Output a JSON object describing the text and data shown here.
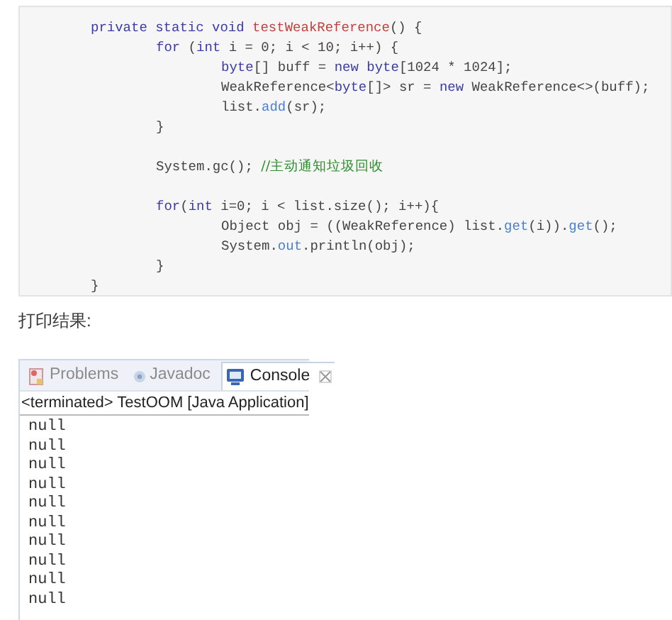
{
  "code": [
    {
      "kind": "line",
      "tokens": [
        {
          "kind": "keyword",
          "text": "private static void "
        },
        {
          "kind": "method",
          "text": "testWeakReference"
        },
        {
          "kind": "plain",
          "text": "() {"
        }
      ],
      "children": [
        {
          "kind": "line",
          "tokens": [
            {
              "kind": "keyword",
              "text": "for"
            },
            {
              "kind": "plain",
              "text": " ("
            },
            {
              "kind": "keyword",
              "text": "int"
            },
            {
              "kind": "plain",
              "text": " i = 0; i < 10; i++) {"
            }
          ],
          "children": [
            {
              "kind": "line",
              "tokens": [
                {
                  "kind": "keyword",
                  "text": "byte"
                },
                {
                  "kind": "plain",
                  "text": "[] buff = "
                },
                {
                  "kind": "keyword",
                  "text": "new byte"
                },
                {
                  "kind": "plain",
                  "text": "[1024 * 1024];"
                }
              ]
            },
            {
              "kind": "line",
              "tokens": [
                {
                  "kind": "plain",
                  "text": "WeakReference<"
                },
                {
                  "kind": "keyword",
                  "text": "byte"
                },
                {
                  "kind": "plain",
                  "text": "[]> sr = "
                },
                {
                  "kind": "keyword",
                  "text": "new"
                },
                {
                  "kind": "plain",
                  "text": " WeakReference<>(buff);"
                }
              ]
            },
            {
              "kind": "line",
              "tokens": [
                {
                  "kind": "plain",
                  "text": "list."
                },
                {
                  "kind": "member",
                  "text": "add"
                },
                {
                  "kind": "plain",
                  "text": "(sr);"
                }
              ]
            }
          ]
        },
        {
          "kind": "line",
          "tokens": [
            {
              "kind": "plain",
              "text": "}"
            }
          ]
        },
        {
          "kind": "blank"
        },
        {
          "kind": "line",
          "tokens": [
            {
              "kind": "plain",
              "text": "System.gc(); "
            },
            {
              "kind": "comment",
              "text": "//主动通知垃圾回收"
            }
          ]
        },
        {
          "kind": "blank"
        },
        {
          "kind": "line",
          "tokens": [
            {
              "kind": "keyword",
              "text": "for"
            },
            {
              "kind": "plain",
              "text": "("
            },
            {
              "kind": "keyword",
              "text": "int"
            },
            {
              "kind": "plain",
              "text": " i=0; i < list.size(); i++){"
            }
          ],
          "children": [
            {
              "kind": "line",
              "tokens": [
                {
                  "kind": "plain",
                  "text": "Object obj = ((WeakReference) list."
                },
                {
                  "kind": "member",
                  "text": "get"
                },
                {
                  "kind": "plain",
                  "text": "(i))."
                },
                {
                  "kind": "member",
                  "text": "get"
                },
                {
                  "kind": "plain",
                  "text": "();"
                }
              ]
            },
            {
              "kind": "line",
              "tokens": [
                {
                  "kind": "plain",
                  "text": "System."
                },
                {
                  "kind": "member",
                  "text": "out"
                },
                {
                  "kind": "plain",
                  "text": ".println(obj);"
                }
              ]
            }
          ]
        },
        {
          "kind": "line",
          "tokens": [
            {
              "kind": "plain",
              "text": "}"
            }
          ]
        }
      ]
    },
    {
      "kind": "line",
      "tokens": [
        {
          "kind": "plain",
          "text": "}"
        }
      ]
    }
  ],
  "result_label": "打印结果:",
  "console": {
    "tabs": [
      {
        "label": "Problems",
        "selected": false
      },
      {
        "label": "Javadoc",
        "selected": false
      },
      {
        "label": "Console",
        "selected": true
      }
    ],
    "header": "<terminated> TestOOM [Java Application]",
    "output": [
      "null",
      "null",
      "null",
      "null",
      "null",
      "null",
      "null",
      "null",
      "null",
      "null"
    ]
  }
}
